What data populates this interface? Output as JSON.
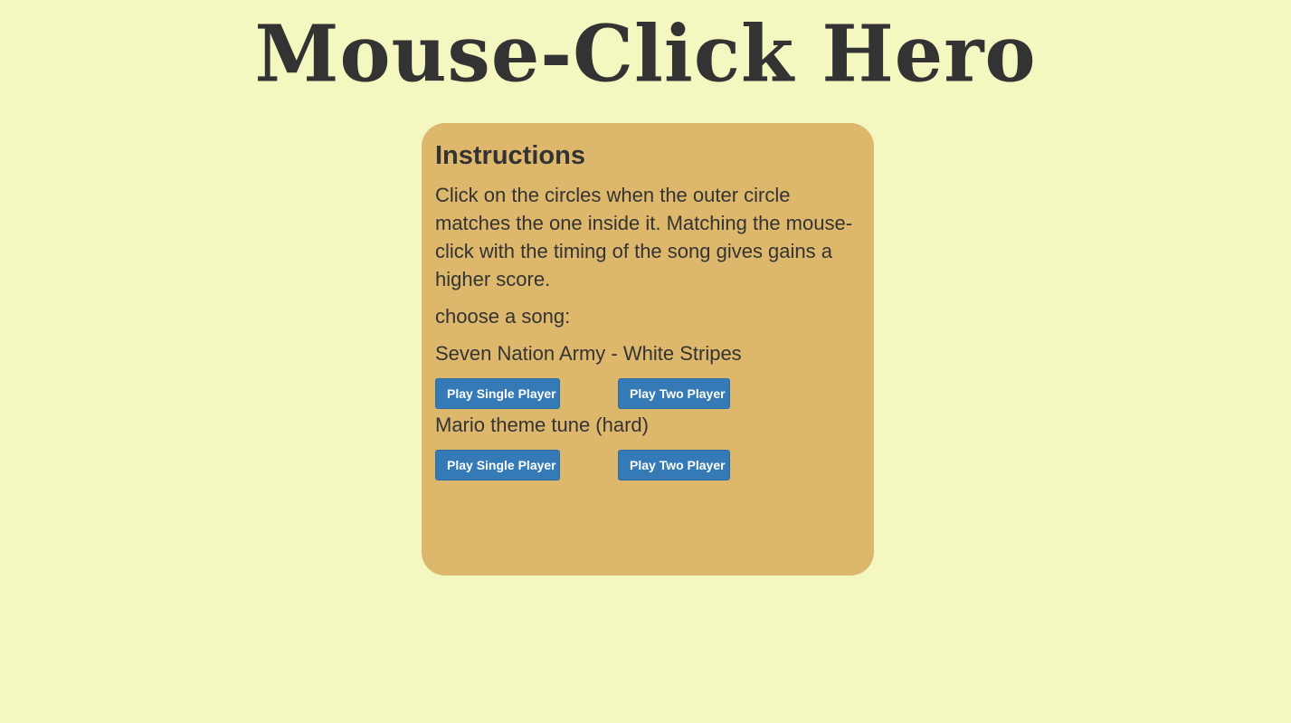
{
  "header": {
    "title": "Mouse-Click Hero"
  },
  "instructions": {
    "heading": "Instructions",
    "body": "Click on the circles when the outer circle matches the one inside it. Matching the mouse-click with the timing of the song gives gains a higher score.",
    "choose_label": "choose a song:"
  },
  "songs": [
    {
      "title": "Seven Nation Army - White Stripes",
      "single_label": "Play Single Player",
      "two_label": "Play Two Player"
    },
    {
      "title": "Mario theme tune (hard)",
      "single_label": "Play Single Player",
      "two_label": "Play Two Player"
    }
  ],
  "colors": {
    "background": "#f4f7c0",
    "panel": "#ddb86c",
    "text": "#333333",
    "button": "#337ab7",
    "button_text": "#ffffff"
  }
}
